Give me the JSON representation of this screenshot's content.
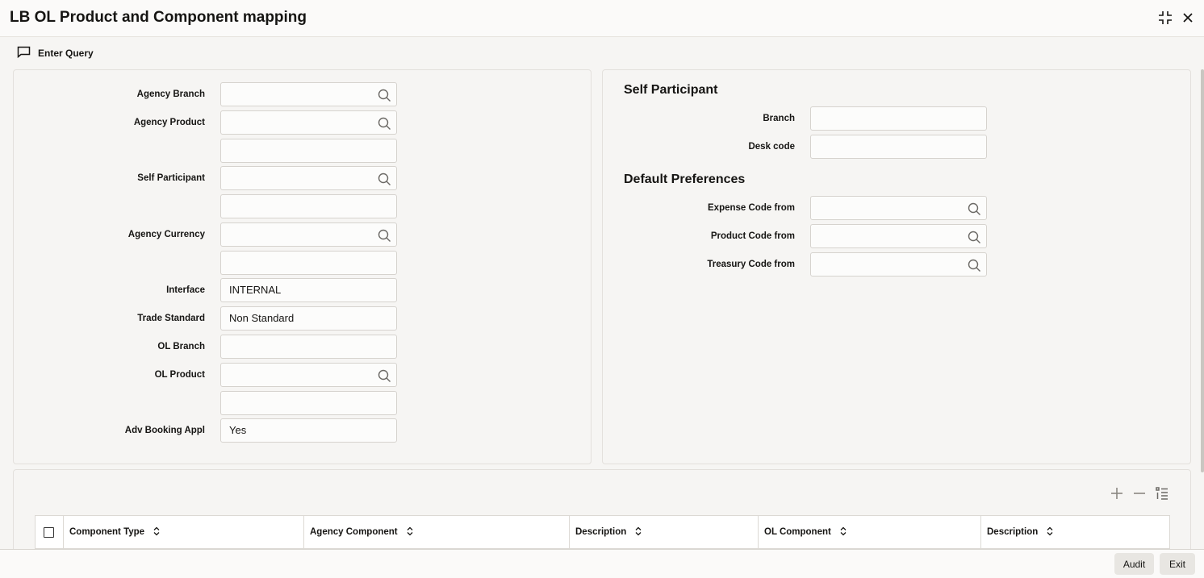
{
  "window": {
    "title": "LB OL Product and Component mapping",
    "restore_icon": "collapse-arrows-icon",
    "close_icon": "close-icon"
  },
  "toolbar": {
    "enter_query_label": "Enter Query",
    "enter_query_icon": "comment-icon"
  },
  "left_form": {
    "agency_branch": {
      "label": "Agency Branch",
      "value": ""
    },
    "agency_product": {
      "label": "Agency Product",
      "value": "",
      "desc": ""
    },
    "self_participant": {
      "label": "Self Participant",
      "value": "",
      "desc": ""
    },
    "agency_currency": {
      "label": "Agency Currency",
      "value": "",
      "desc": ""
    },
    "interface": {
      "label": "Interface",
      "value": "INTERNAL"
    },
    "trade_standard": {
      "label": "Trade Standard",
      "value": "Non Standard"
    },
    "ol_branch": {
      "label": "OL Branch",
      "value": ""
    },
    "ol_product": {
      "label": "OL Product",
      "value": "",
      "desc": ""
    },
    "adv_booking_appl": {
      "label": "Adv Booking Appl",
      "value": "Yes"
    }
  },
  "right_form": {
    "self_participant_title": "Self Participant",
    "branch": {
      "label": "Branch",
      "value": ""
    },
    "desk_code": {
      "label": "Desk code",
      "value": ""
    },
    "default_preferences_title": "Default Preferences",
    "expense_code_from": {
      "label": "Expense Code from",
      "value": ""
    },
    "product_code_from": {
      "label": "Product Code from",
      "value": ""
    },
    "treasury_code_from": {
      "label": "Treasury Code from",
      "value": ""
    }
  },
  "grid": {
    "columns": [
      "Component Type",
      "Agency Component",
      "Description",
      "OL Component",
      "Description"
    ],
    "actions": [
      "add-icon",
      "remove-icon",
      "list-icon"
    ]
  },
  "footer": {
    "audit_label": "Audit",
    "exit_label": "Exit"
  },
  "colors": {
    "background": "#f6f5f3",
    "field_border": "#d6d3ce",
    "text": "#161513"
  }
}
